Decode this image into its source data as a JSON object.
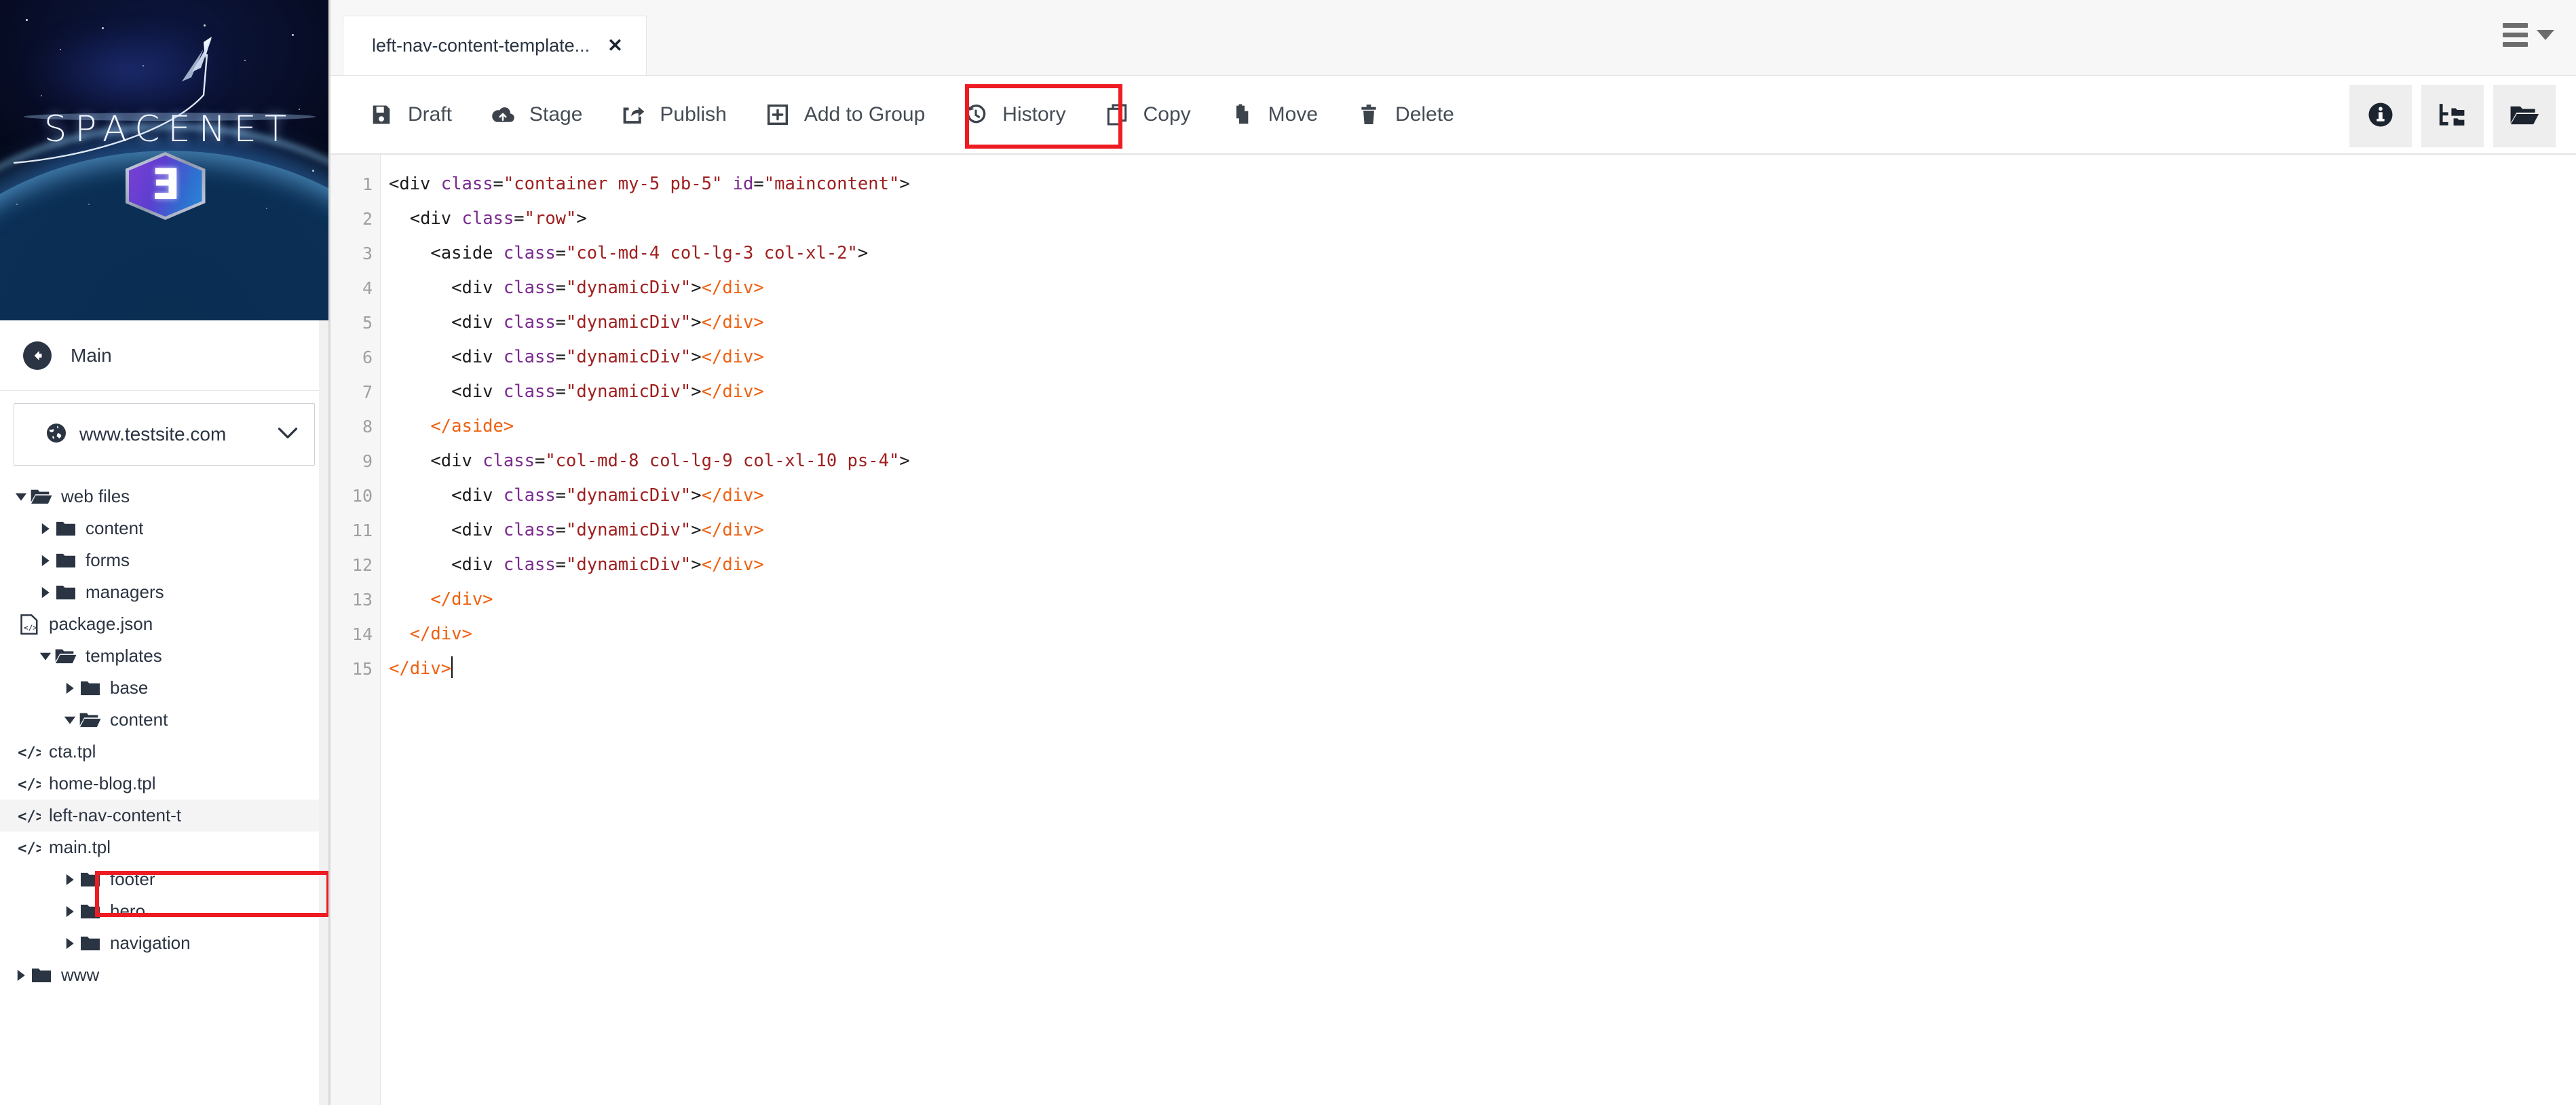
{
  "sidebar": {
    "logo": {
      "wordmark": "SPACENET",
      "badge_glyph": "Ǝ",
      "alt": "spacenet-logo"
    },
    "back_label": "Main",
    "back_icon": "arrow-circle-left-icon",
    "site": {
      "icon": "globe-icon",
      "name": "www.testsite.com",
      "chevron": "chevron-down-icon"
    },
    "tree": [
      {
        "label": "web files",
        "depth": 0,
        "type": "folder-open",
        "twisty": "down",
        "selected": false
      },
      {
        "label": "content",
        "depth": 1,
        "type": "folder",
        "twisty": "right",
        "selected": false
      },
      {
        "label": "forms",
        "depth": 1,
        "type": "folder",
        "twisty": "right",
        "selected": false
      },
      {
        "label": "managers",
        "depth": 1,
        "type": "folder",
        "twisty": "right",
        "selected": false
      },
      {
        "label": "package.json",
        "depth": 1,
        "type": "file-json",
        "twisty": "none",
        "selected": false
      },
      {
        "label": "templates",
        "depth": 1,
        "type": "folder-open",
        "twisty": "down",
        "selected": false
      },
      {
        "label": "base",
        "depth": 2,
        "type": "folder",
        "twisty": "right",
        "selected": false
      },
      {
        "label": "content",
        "depth": 2,
        "type": "folder-open",
        "twisty": "down",
        "selected": false
      },
      {
        "label": "cta.tpl",
        "depth": 3,
        "type": "file-code",
        "twisty": "none",
        "selected": false
      },
      {
        "label": "home-blog.tpl",
        "depth": 3,
        "type": "file-code",
        "twisty": "none",
        "selected": false
      },
      {
        "label": "left-nav-content-t",
        "depth": 3,
        "type": "file-code",
        "twisty": "none",
        "selected": true
      },
      {
        "label": "main.tpl",
        "depth": 3,
        "type": "file-code",
        "twisty": "none",
        "selected": false
      },
      {
        "label": "footer",
        "depth": 2,
        "type": "folder",
        "twisty": "right",
        "selected": false
      },
      {
        "label": "hero",
        "depth": 2,
        "type": "folder",
        "twisty": "right",
        "selected": false
      },
      {
        "label": "navigation",
        "depth": 2,
        "type": "folder",
        "twisty": "right",
        "selected": false
      },
      {
        "label": "www",
        "depth": 0,
        "type": "folder",
        "twisty": "right",
        "selected": false
      }
    ],
    "highlight_color": "#ee1c22"
  },
  "tabs": {
    "active_label": "left-nav-content-template...",
    "close_glyph": "✕",
    "menu_icon": "hamburger-menu-icon"
  },
  "toolbar": {
    "buttons": [
      {
        "label": "Draft",
        "icon": "save-icon"
      },
      {
        "label": "Stage",
        "icon": "cloud-upload-icon"
      },
      {
        "label": "Publish",
        "icon": "share-external-icon"
      },
      {
        "label": "Add to Group",
        "icon": "plus-square-icon"
      },
      {
        "label": "History",
        "icon": "history-clock-icon"
      },
      {
        "label": "Copy",
        "icon": "copy-icon"
      },
      {
        "label": "Move",
        "icon": "move-clipboard-icon"
      },
      {
        "label": "Delete",
        "icon": "trash-icon"
      }
    ],
    "highlighted_button": "Publish",
    "right_buttons": [
      {
        "icon": "info-circle-icon"
      },
      {
        "icon": "sitemap-folder-icon"
      },
      {
        "icon": "folder-open-icon"
      }
    ]
  },
  "editor": {
    "line_numbers": [
      "1",
      "2",
      "3",
      "4",
      "5",
      "6",
      "7",
      "8",
      "9",
      "10",
      "11",
      "12",
      "13",
      "14",
      "15"
    ],
    "lines": [
      "<div class=\"container my-5 pb-5\" id=\"maincontent\">",
      "  <div class=\"row\">",
      "    <aside class=\"col-md-4 col-lg-3 col-xl-2\">",
      "      <div class=\"dynamicDiv\"></div>",
      "      <div class=\"dynamicDiv\"></div>",
      "      <div class=\"dynamicDiv\"></div>",
      "      <div class=\"dynamicDiv\"></div>",
      "    </aside>",
      "    <div class=\"col-md-8 col-lg-9 col-xl-10 ps-4\">",
      "      <div class=\"dynamicDiv\"></div>",
      "      <div class=\"dynamicDiv\"></div>",
      "      <div class=\"dynamicDiv\"></div>",
      "    </div>",
      "  </div>",
      "</div>"
    ],
    "cursor_line": 15
  },
  "colors": {
    "accent_red": "#ee1c22",
    "sidebar_text": "#2b3442",
    "toolbar_text": "#444c55",
    "gutter_bg": "#f6f6f6",
    "tab_bg": "#f7f7f7"
  }
}
